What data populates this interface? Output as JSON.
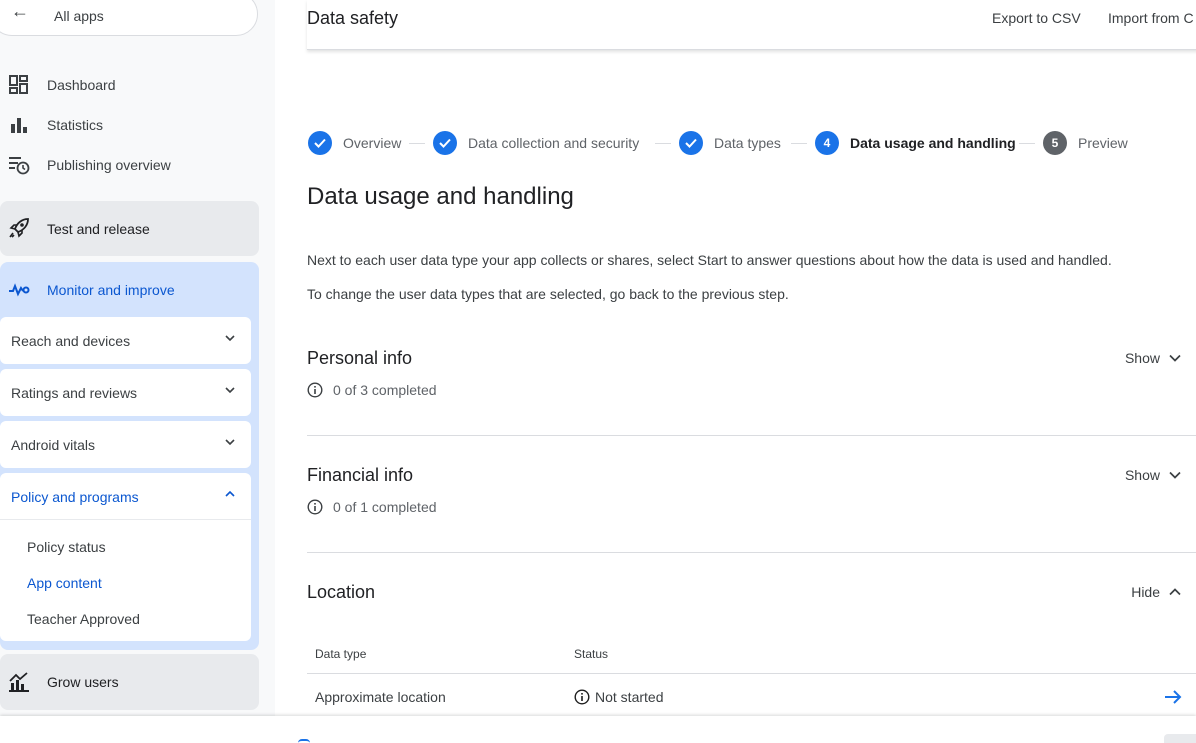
{
  "sidebar": {
    "all_apps": "All apps",
    "nav": [
      "Dashboard",
      "Statistics",
      "Publishing overview"
    ],
    "test_release": "Test and release",
    "monitor": "Monitor and improve",
    "sub_items": [
      "Reach and devices",
      "Ratings and reviews",
      "Android vitals"
    ],
    "policy": {
      "label": "Policy and programs",
      "items": [
        "Policy status",
        "App content",
        "Teacher Approved"
      ]
    },
    "grow": "Grow users"
  },
  "header": {
    "title": "Data safety",
    "export": "Export to CSV",
    "import": "Import from C"
  },
  "stepper": {
    "steps": [
      {
        "label": "Overview",
        "state": "done"
      },
      {
        "label": "Data collection and security",
        "state": "done"
      },
      {
        "label": "Data types",
        "state": "done"
      },
      {
        "label": "Data usage and handling",
        "state": "current",
        "number": "4"
      },
      {
        "label": "Preview",
        "state": "todo",
        "number": "5"
      }
    ]
  },
  "main": {
    "title": "Data usage and handling",
    "desc1": "Next to each user data type your app collects or shares, select Start to answer questions about how the data is used and handled.",
    "desc2": "To change the user data types that are selected, go back to the previous step."
  },
  "categories": [
    {
      "title": "Personal info",
      "progress": "0 of 3 completed",
      "toggle": "Show"
    },
    {
      "title": "Financial info",
      "progress": "0 of 1 completed",
      "toggle": "Show"
    },
    {
      "title": "Location",
      "toggle": "Hide"
    }
  ],
  "table": {
    "col_type": "Data type",
    "col_status": "Status",
    "rows": [
      {
        "type": "Approximate location",
        "status": "Not started"
      }
    ]
  },
  "colors": {
    "accent": "#1a73e8",
    "active_section": "#d3e3fd",
    "link": "#0b57d0"
  }
}
